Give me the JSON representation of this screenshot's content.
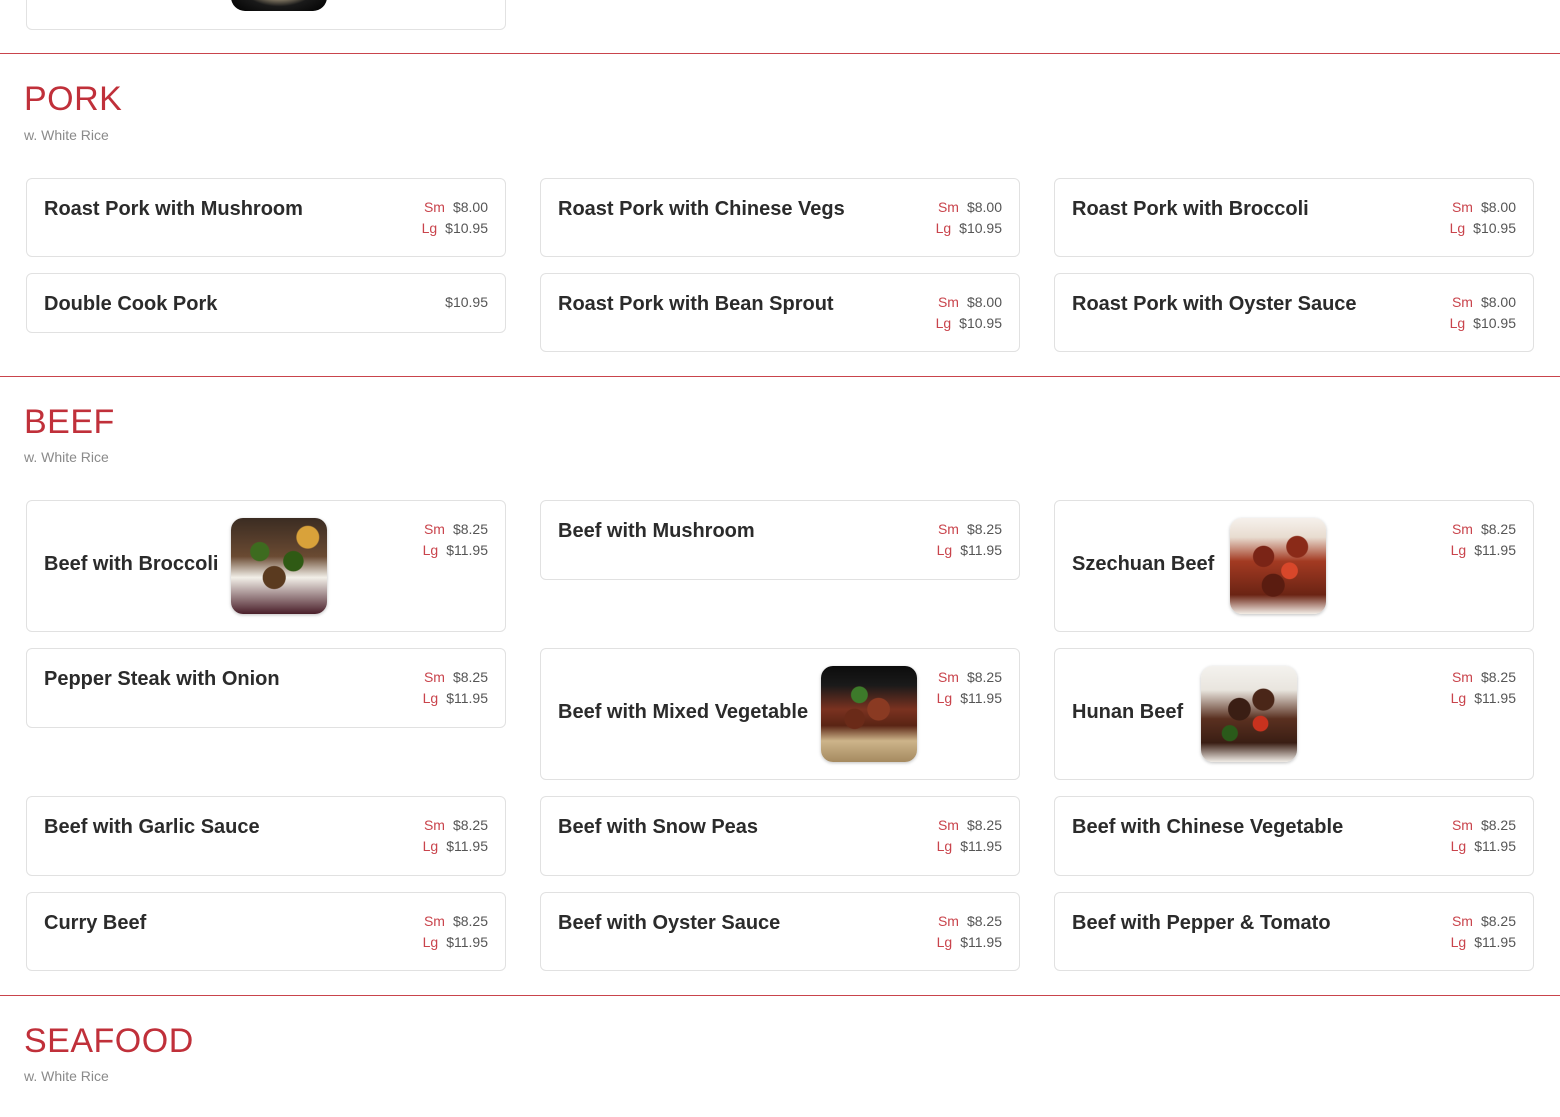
{
  "pork": {
    "title": "PORK",
    "subtitle": "w. White Rice",
    "items": [
      {
        "name": "Roast Pork with Mushroom",
        "sm_label": "Sm",
        "sm": "$8.00",
        "lg_label": "Lg",
        "lg": "$10.95"
      },
      {
        "name": "Roast Pork with Chinese Vegs",
        "sm_label": "Sm",
        "sm": "$8.00",
        "lg_label": "Lg",
        "lg": "$10.95"
      },
      {
        "name": "Roast Pork with Broccoli",
        "sm_label": "Sm",
        "sm": "$8.00",
        "lg_label": "Lg",
        "lg": "$10.95"
      },
      {
        "name": "Double Cook Pork",
        "price": "$10.95"
      },
      {
        "name": "Roast Pork with Bean Sprout",
        "sm_label": "Sm",
        "sm": "$8.00",
        "lg_label": "Lg",
        "lg": "$10.95"
      },
      {
        "name": "Roast Pork with Oyster Sauce",
        "sm_label": "Sm",
        "sm": "$8.00",
        "lg_label": "Lg",
        "lg": "$10.95"
      }
    ]
  },
  "beef": {
    "title": "BEEF",
    "subtitle": "w. White Rice",
    "items": [
      {
        "name": "Beef with Broccoli",
        "sm_label": "Sm",
        "sm": "$8.25",
        "lg_label": "Lg",
        "lg": "$11.95",
        "image": "beef-broccoli-photo"
      },
      {
        "name": "Beef with Mushroom",
        "sm_label": "Sm",
        "sm": "$8.25",
        "lg_label": "Lg",
        "lg": "$11.95"
      },
      {
        "name": "Szechuan Beef",
        "sm_label": "Sm",
        "sm": "$8.25",
        "lg_label": "Lg",
        "lg": "$11.95",
        "image": "szechuan-beef-photo"
      },
      {
        "name": "Pepper Steak with Onion",
        "sm_label": "Sm",
        "sm": "$8.25",
        "lg_label": "Lg",
        "lg": "$11.95"
      },
      {
        "name": "Beef with Mixed Vegetable",
        "sm_label": "Sm",
        "sm": "$8.25",
        "lg_label": "Lg",
        "lg": "$11.95",
        "image": "beef-mixed-vegetable-photo"
      },
      {
        "name": "Hunan Beef",
        "sm_label": "Sm",
        "sm": "$8.25",
        "lg_label": "Lg",
        "lg": "$11.95",
        "image": "hunan-beef-photo"
      },
      {
        "name": "Beef with Garlic Sauce",
        "sm_label": "Sm",
        "sm": "$8.25",
        "lg_label": "Lg",
        "lg": "$11.95"
      },
      {
        "name": "Beef with Snow Peas",
        "sm_label": "Sm",
        "sm": "$8.25",
        "lg_label": "Lg",
        "lg": "$11.95"
      },
      {
        "name": "Beef with Chinese Vegetable",
        "sm_label": "Sm",
        "sm": "$8.25",
        "lg_label": "Lg",
        "lg": "$11.95"
      },
      {
        "name": "Curry Beef",
        "sm_label": "Sm",
        "sm": "$8.25",
        "lg_label": "Lg",
        "lg": "$11.95"
      },
      {
        "name": "Beef with Oyster Sauce",
        "sm_label": "Sm",
        "sm": "$8.25",
        "lg_label": "Lg",
        "lg": "$11.95"
      },
      {
        "name": "Beef with Pepper & Tomato",
        "sm_label": "Sm",
        "sm": "$8.25",
        "lg_label": "Lg",
        "lg": "$11.95"
      }
    ]
  },
  "seafood": {
    "title": "SEAFOOD",
    "subtitle": "w. White Rice"
  },
  "colors": {
    "accent": "#c0303a",
    "divider": "#c9444c",
    "card_border": "#e1e1e1"
  }
}
